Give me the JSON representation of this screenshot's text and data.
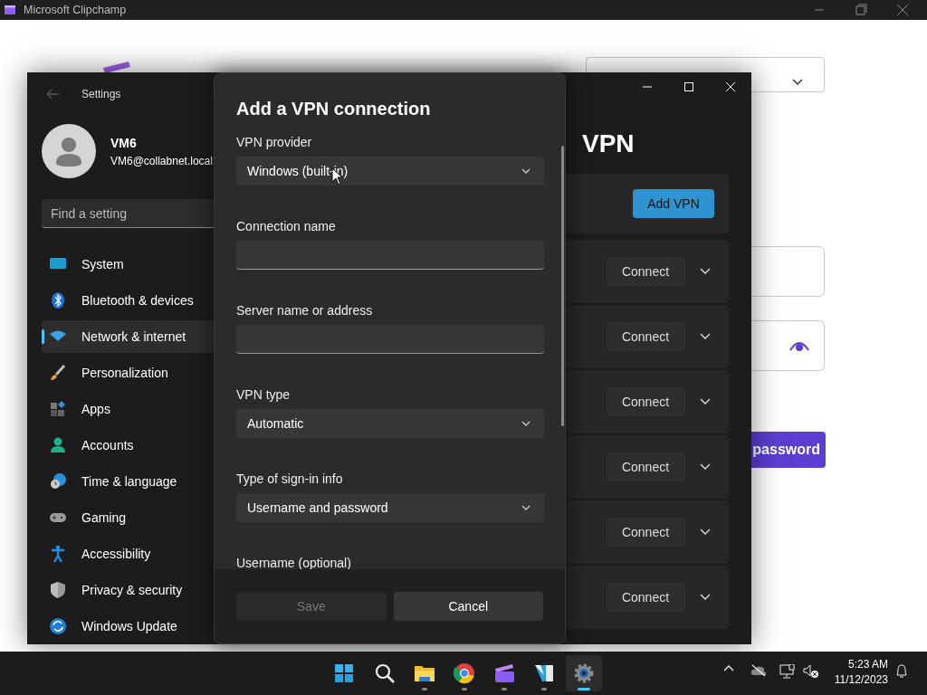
{
  "background_app": {
    "title": "Microsoft Clipchamp",
    "button_text": "password"
  },
  "settings": {
    "title": "Settings",
    "user": {
      "name": "VM6",
      "email": "VM6@collabnet.local"
    },
    "search": {
      "placeholder": "Find a setting"
    },
    "nav": [
      {
        "label": "System",
        "selected": false
      },
      {
        "label": "Bluetooth & devices",
        "selected": false
      },
      {
        "label": "Network & internet",
        "selected": true
      },
      {
        "label": "Personalization",
        "selected": false
      },
      {
        "label": "Apps",
        "selected": false
      },
      {
        "label": "Accounts",
        "selected": false
      },
      {
        "label": "Time & language",
        "selected": false
      },
      {
        "label": "Gaming",
        "selected": false
      },
      {
        "label": "Accessibility",
        "selected": false
      },
      {
        "label": "Privacy & security",
        "selected": false
      },
      {
        "label": "Windows Update",
        "selected": false
      }
    ],
    "page_title": "VPN",
    "add_button": "Add VPN",
    "connections": [
      {
        "button": "Connect"
      },
      {
        "button": "Connect"
      },
      {
        "button": "Connect"
      },
      {
        "button": "Connect"
      },
      {
        "button": "Connect"
      },
      {
        "button": "Connect"
      }
    ]
  },
  "dialog": {
    "title": "Add a VPN connection",
    "fields": [
      {
        "kind": "select",
        "label": "VPN provider",
        "value": "Windows (built-in)"
      },
      {
        "kind": "text",
        "label": "Connection name"
      },
      {
        "kind": "text",
        "label": "Server name or address"
      },
      {
        "kind": "select",
        "label": "VPN type",
        "value": "Automatic"
      },
      {
        "kind": "select",
        "label": "Type of sign-in info",
        "value": "Username and password"
      },
      {
        "kind": "cut",
        "label": "Username (optional)"
      }
    ],
    "buttons": [
      {
        "label": "Save",
        "disabled": true
      },
      {
        "label": "Cancel",
        "disabled": false
      }
    ]
  },
  "taskbar": {
    "apps": [
      {
        "running": false,
        "selected": false
      },
      {
        "running": false,
        "selected": false
      },
      {
        "running": true,
        "selected": false
      },
      {
        "running": true,
        "selected": false
      },
      {
        "running": true,
        "selected": false
      },
      {
        "running": true,
        "selected": false
      },
      {
        "running": true,
        "selected": true
      }
    ],
    "time": "5:23 AM",
    "date": "11/12/2023"
  }
}
